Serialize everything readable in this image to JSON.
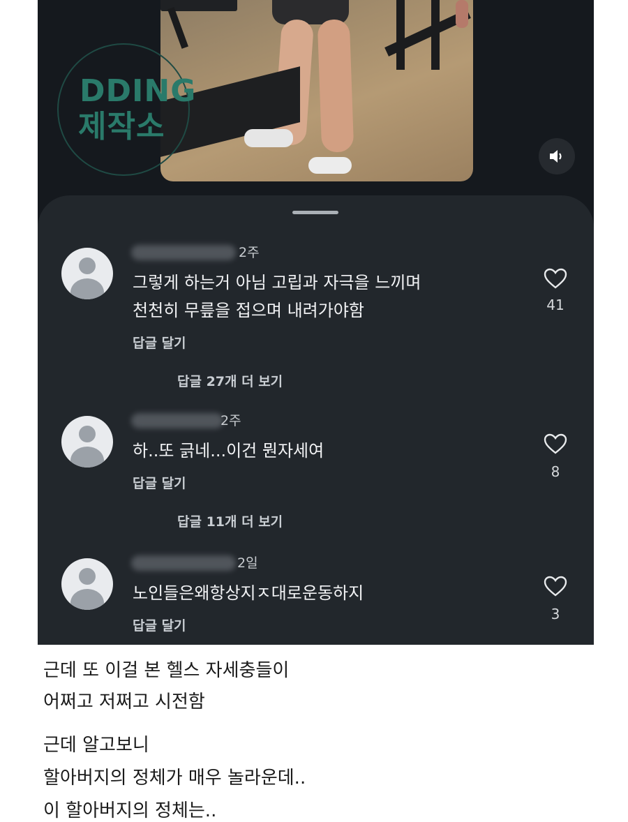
{
  "logo": {
    "line1": "DDING",
    "line2": "제작소"
  },
  "comments": [
    {
      "time": "2주",
      "text_lines": [
        "그렇게 하는거 아님 고립과 자극을 느끼며",
        "천천히 무릎을 접으며 내려가야함"
      ],
      "reply_label": "답글 달기",
      "likes": "41",
      "more_replies": "답글 27개 더 보기"
    },
    {
      "time": "2주",
      "text_lines": [
        "하..또 긁네...이건 뭔자세여"
      ],
      "reply_label": "답글 달기",
      "likes": "8",
      "more_replies": "답글 11개 더 보기"
    },
    {
      "time": "2일",
      "text_lines": [
        "노인들은왜항상지ㅈ대로운동하지"
      ],
      "reply_label": "답글 달기",
      "likes": "3"
    }
  ],
  "caption": [
    "근데 또 이걸 본 헬스 자세충들이",
    "어쩌고 저쩌고 시전함",
    "근데 알고보니",
    "할아버지의 정체가 매우 놀라운데..",
    "이 할아버지의 정체는.."
  ],
  "icons": {
    "sound": "speaker-icon",
    "like": "heart-icon",
    "avatar": "default-avatar-icon"
  }
}
